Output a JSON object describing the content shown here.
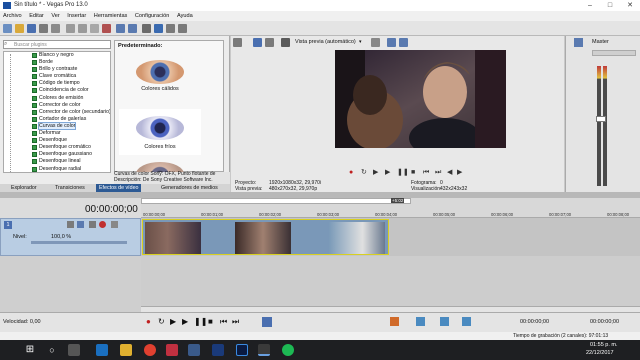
{
  "window": {
    "title": "Sin título * - Vegas Pro 13.0",
    "accent": "#2d5a94"
  },
  "menu": [
    "Archivo",
    "Editar",
    "Ver",
    "Insertar",
    "Herramientas",
    "Configuración",
    "Ayuda"
  ],
  "left_panel": {
    "search_placeholder": "Buscar plugins",
    "fx_items": [
      "Blanco y negro",
      "Borde",
      "Brillo y contraste",
      "Clave cromática",
      "Código de tiempo",
      "Coincidencia de color",
      "Colores de emisión",
      "Corrector de color",
      "Corrector de color (secundario)",
      "Cortador de galerías",
      "Curvas de color",
      "Deformar",
      "Desenfoque",
      "Desenfoque cromático",
      "Desenfoque gaussiano",
      "Desenfoque lineal",
      "Desenfoque radial"
    ],
    "selected_fx": "Curvas de color",
    "presets_header": "Predeterminado:",
    "presets": [
      "Colores cálidos",
      "Colores fríos",
      ""
    ],
    "preset_description_1": "Curvas de color Sony: OFX, Punto flotante de",
    "preset_description_2": "Descripción: De Sony Creative Software Inc.",
    "tabs": [
      "Explorador",
      "Transiciones",
      "Efectos de vídeo",
      "Generadores de medios"
    ],
    "active_tab": "Efectos de vídeo"
  },
  "preview": {
    "mode_label": "Vista previa (automático)",
    "info": {
      "proyecto_label": "Proyecto:",
      "proyecto_value": "1920x1080x32, 29,970i",
      "vista_label": "Vista previa:",
      "vista_value": "480x270x32, 29,970p",
      "fotograma_label": "Fotograma:",
      "fotograma_value": "0",
      "visualizacion_label": "Visualización:",
      "visualizacion_value": "432x243x32"
    }
  },
  "mixer": {
    "title": "Master"
  },
  "timeline": {
    "timecode": "00:00:00;00",
    "marker": "+5:02",
    "ruler_labels": [
      "00:00:00;00",
      "00:00:01;00",
      "00:00:02;00",
      "00:00:03;00",
      "00:00:04;00",
      "00:00:05;00",
      "00:00:06;00",
      "00:00:07;00",
      "00:00:08;00"
    ],
    "track": {
      "number": "1",
      "level_label": "Nivel:",
      "level_value": "100,0 %"
    }
  },
  "bottom": {
    "velocidad": "Velocidad: 0,00",
    "time_display_1": "00:00:00;00",
    "time_display_2": "00:00:00;00"
  },
  "status": {
    "text": "Tiempo de grabación (2 canales): 97:01:13"
  },
  "taskbar": {
    "time": "01:55 p. m.",
    "date": "22/12/2017"
  }
}
